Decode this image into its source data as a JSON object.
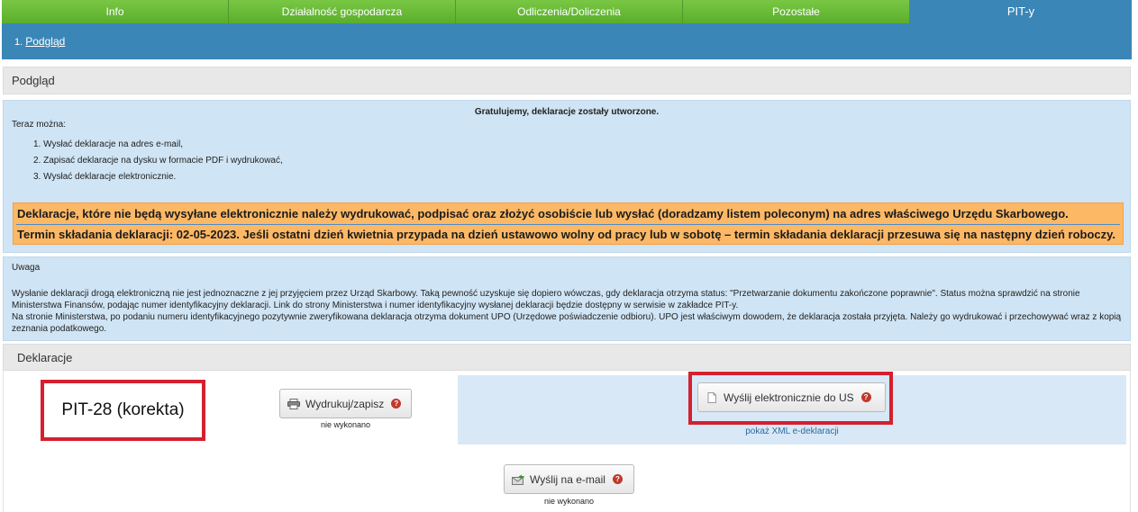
{
  "tabs": [
    {
      "label": "Info"
    },
    {
      "label": "Działalność gospodarcza"
    },
    {
      "label": "Odliczenia/Doliczenia"
    },
    {
      "label": "Pozostałe"
    },
    {
      "label": "PIT-y"
    }
  ],
  "subnav": {
    "step_number": "1.",
    "step_label": "Podgląd"
  },
  "podglad_header": "Podgląd",
  "info": {
    "congrats": "Gratulujemy, deklaracje zostały utworzone.",
    "intro": "Teraz można:",
    "items": [
      "1. Wysłać deklaracje na adres e-mail,",
      "2. Zapisać deklaracje na dysku w formacie PDF i wydrukować,",
      "3. Wysłać deklaracje elektronicznie."
    ]
  },
  "warning": {
    "line1": "Deklaracje, które nie będą wysyłane elektronicznie należy wydrukować, podpisać oraz złożyć osobiście lub wysłać (doradzamy listem poleconym) na adres właściwego Urzędu Skarbowego.",
    "line2": "Termin składania deklaracji: 02-05-2023. Jeśli ostatni dzień kwietnia przypada na dzień ustawowo wolny od pracy lub w sobotę – termin składania deklaracji przesuwa się na następny dzień roboczy."
  },
  "uwaga": {
    "title": "Uwaga",
    "body": "Wysłanie deklaracji drogą elektroniczną nie jest jednoznaczne z jej przyjęciem przez Urząd Skarbowy. Taką pewność uzyskuje się dopiero wówczas, gdy deklaracja otrzyma status: \"Przetwarzanie dokumentu zakończone poprawnie\". Status można sprawdzić na stronie Ministerstwa Finansów, podając numer identyfikacyjny deklaracji. Link do strony Ministerstwa i numer identyfikacyjny wysłanej deklaracji będzie dostępny w serwisie w zakładce PIT-y.\nNa stronie Ministerstwa, po podaniu numeru identyfikacyjnego pozytywnie zweryfikowana deklaracja otrzyma dokument UPO (Urzędowe poświadczenie odbioru). UPO jest właściwym dowodem, że deklaracja została przyjęta. Należy go wydrukować i przechowywać wraz z kopią zeznania podatkowego."
  },
  "deklaracje_header": "Deklaracje",
  "declaration": {
    "name": "PIT-28 (korekta)",
    "print_button": "Wydrukuj/zapisz",
    "print_status": "nie wykonano",
    "send_us_button": "Wyślij elektronicznie do US",
    "xml_link": "pokaż XML e-deklaracji",
    "email_button": "Wyślij na e-mail",
    "email_status": "nie wykonano",
    "help_glyph": "?"
  },
  "colors": {
    "tab_green": "#5aae2b",
    "tab_active_blue": "#3a86b6",
    "info_bg": "#cfe4f4",
    "warning_bg": "#fdb865",
    "highlight_red": "#d5202f"
  }
}
